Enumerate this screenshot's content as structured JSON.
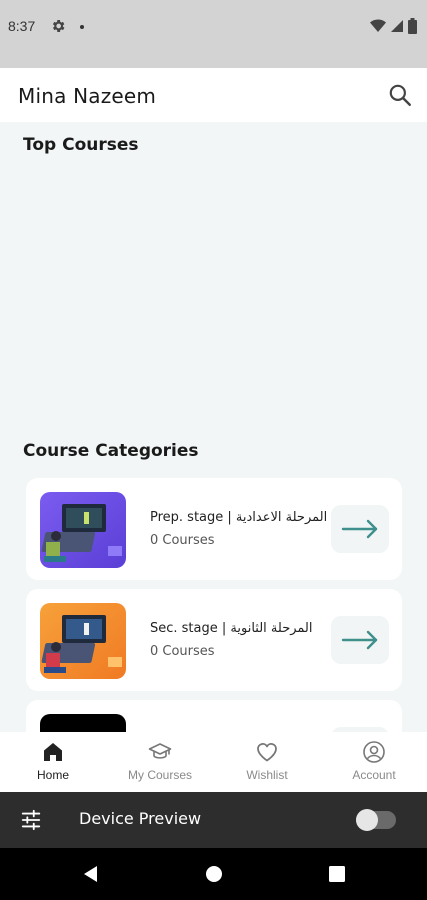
{
  "status_bar": {
    "time": "8:37"
  },
  "app_bar": {
    "title": "Mina Nazeem"
  },
  "sections": {
    "top_courses": "Top Courses",
    "categories": "Course Categories"
  },
  "categories": [
    {
      "title": "Prep. stage | المرحلة الاعدادية",
      "count": "0 Courses"
    },
    {
      "title": "Sec. stage | المرحلة الثانوية",
      "count": "0 Courses"
    }
  ],
  "bottom_nav": [
    {
      "label": "Home",
      "icon": "home-icon",
      "active": true
    },
    {
      "label": "My Courses",
      "icon": "graduation-cap-icon",
      "active": false
    },
    {
      "label": "Wishlist",
      "icon": "heart-icon",
      "active": false
    },
    {
      "label": "Account",
      "icon": "account-icon",
      "active": false
    }
  ],
  "device_preview": {
    "label": "Device Preview",
    "enabled": false
  },
  "colors": {
    "accent": "#3f8f8c",
    "content_bg": "#f3f6f7",
    "preview_bar": "#2d2d2d"
  }
}
